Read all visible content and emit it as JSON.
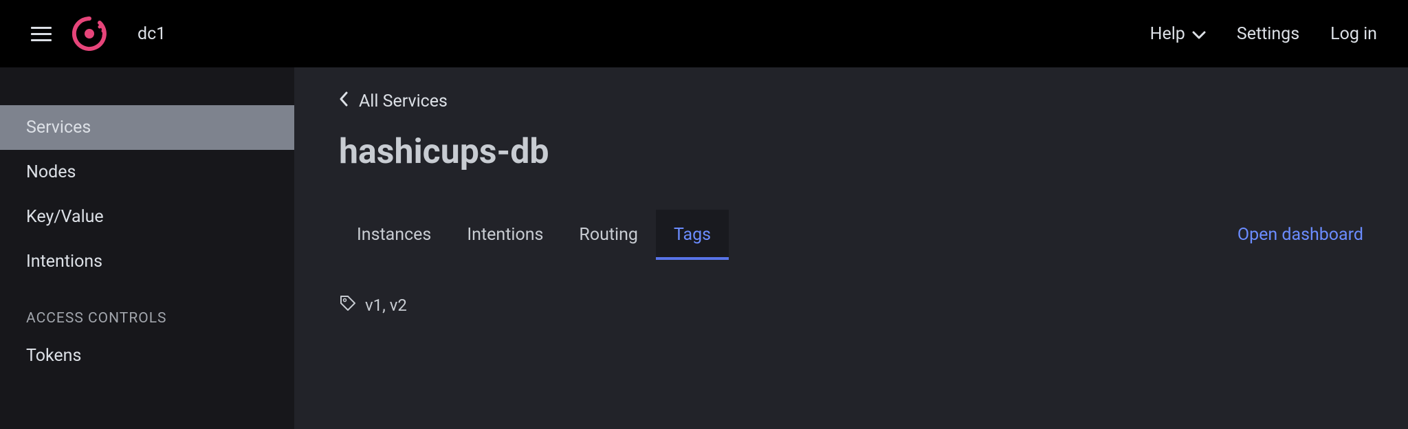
{
  "header": {
    "datacenter": "dc1",
    "help_label": "Help",
    "settings_label": "Settings",
    "login_label": "Log in"
  },
  "sidebar": {
    "items": [
      {
        "label": "Services",
        "active": true
      },
      {
        "label": "Nodes",
        "active": false
      },
      {
        "label": "Key/Value",
        "active": false
      },
      {
        "label": "Intentions",
        "active": false
      }
    ],
    "section_header": "ACCESS CONTROLS",
    "access_items": [
      {
        "label": "Tokens"
      }
    ]
  },
  "main": {
    "breadcrumb_label": "All Services",
    "title": "hashicups-db",
    "tabs": [
      {
        "label": "Instances",
        "active": false
      },
      {
        "label": "Intentions",
        "active": false
      },
      {
        "label": "Routing",
        "active": false
      },
      {
        "label": "Tags",
        "active": true
      }
    ],
    "open_dashboard_label": "Open dashboard",
    "tags_text": "v1, v2"
  }
}
